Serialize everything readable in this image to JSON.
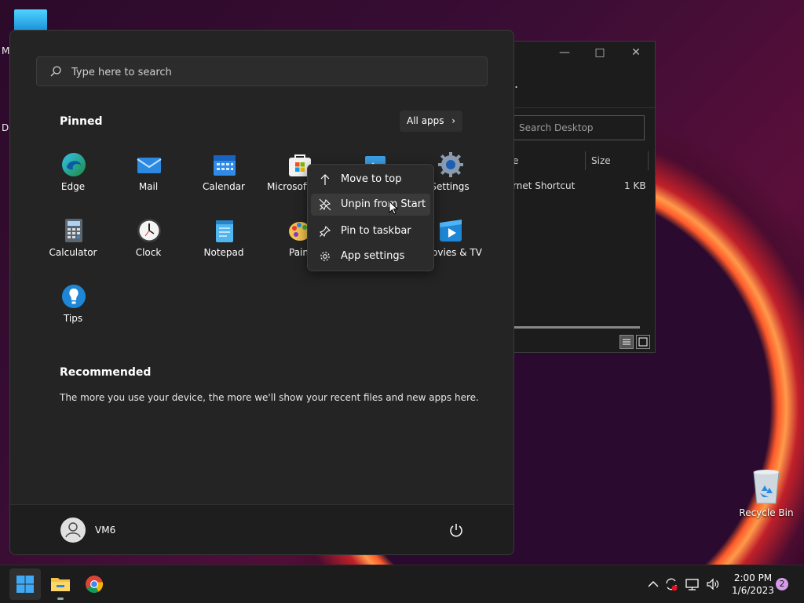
{
  "desktop": {
    "edge_letters": [
      "M",
      "Da"
    ],
    "recycle_bin_label": "Recycle Bin"
  },
  "explorer": {
    "search_placeholder": "Search Desktop",
    "col_name_partial": "e",
    "col_size": "Size",
    "row_type_partial": "rnet Shortcut",
    "row_size": "1 KB",
    "minimize_icon": "minimize-icon",
    "maximize_icon": "maximize-icon",
    "close_icon": "close-icon"
  },
  "start": {
    "search_placeholder": "Type here to search",
    "pinned_title": "Pinned",
    "all_apps_label": "All apps",
    "apps": [
      {
        "name": "Edge",
        "icon": "edge-icon"
      },
      {
        "name": "Mail",
        "icon": "mail-icon"
      },
      {
        "name": "Calendar",
        "icon": "calendar-icon"
      },
      {
        "name": "Microsoft",
        "icon": "store-icon"
      },
      {
        "name": "",
        "icon": "photos-icon"
      },
      {
        "name": "Settings",
        "icon": "settings-icon"
      },
      {
        "name": "Calculator",
        "icon": "calculator-icon"
      },
      {
        "name": "Clock",
        "icon": "clock-icon"
      },
      {
        "name": "Notepad",
        "icon": "notepad-icon"
      },
      {
        "name": "Pain",
        "icon": "paint-icon"
      },
      {
        "name": "ovies & TV",
        "icon": "movies-tv-icon"
      },
      {
        "name": "Tips",
        "icon": "tips-icon"
      }
    ],
    "recommended_title": "Recommended",
    "recommended_text": "The more you use your device, the more we'll show your recent files and new apps here.",
    "user_name": "VM6"
  },
  "context_menu": {
    "items": [
      {
        "label": "Move to top",
        "icon": "arrow-up-icon"
      },
      {
        "label": "Unpin from Start",
        "icon": "unpin-icon"
      },
      {
        "label": "Pin to taskbar",
        "icon": "pin-icon"
      },
      {
        "label": "App settings",
        "icon": "gear-icon"
      }
    ]
  },
  "taskbar": {
    "time": "2:00 PM",
    "date": "1/6/2023",
    "notification_count": "2"
  },
  "colors": {
    "accent": "#0078d4",
    "menu_bg": "#242424",
    "taskbar_bg": "#1c1c1c"
  }
}
